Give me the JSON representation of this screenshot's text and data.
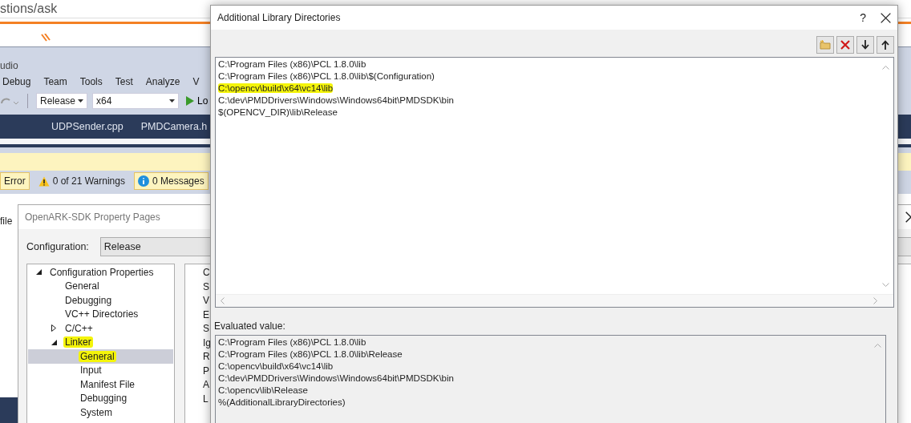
{
  "browser": {
    "address_fragment": "stions/ask"
  },
  "ide": {
    "title_fragment": "udio",
    "menu": [
      "Debug",
      "Team",
      "Tools",
      "Test",
      "Analyze",
      "V"
    ],
    "configuration": "Release",
    "platform": "x64",
    "run_label": "Lo",
    "tabs": [
      {
        "label": "UDPSender.cpp",
        "selected": false
      },
      {
        "label": "PMDCamera.h",
        "selected": false
      }
    ],
    "error_filters": [
      {
        "kind": "error",
        "label": "Error",
        "selected": true
      },
      {
        "kind": "warning",
        "label": "0 of 21 Warnings",
        "selected": false
      },
      {
        "kind": "info",
        "label": "0 Messages",
        "selected": true
      }
    ],
    "text_fragment": "file"
  },
  "property_pages": {
    "title": "OpenARK-SDK Property Pages",
    "configuration_label": "Configuration:",
    "configuration": "Release",
    "tree": [
      {
        "label": "Configuration Properties",
        "expanded": true,
        "selected": false,
        "highlighted": false,
        "children": [
          {
            "label": "General",
            "selected": false,
            "highlighted": false
          },
          {
            "label": "Debugging",
            "selected": false,
            "highlighted": false
          },
          {
            "label": "VC++ Directories",
            "selected": false,
            "highlighted": false
          },
          {
            "label": "C/C++",
            "expanded": false,
            "selected": false,
            "highlighted": false
          },
          {
            "label": "Linker",
            "expanded": true,
            "selected": false,
            "highlighted": true,
            "children": [
              {
                "label": "General",
                "selected": true,
                "highlighted": true
              },
              {
                "label": "Input",
                "selected": false,
                "highlighted": false
              },
              {
                "label": "Manifest File",
                "selected": false,
                "highlighted": false
              },
              {
                "label": "Debugging",
                "selected": false,
                "highlighted": false
              },
              {
                "label": "System",
                "selected": false,
                "highlighted": false
              }
            ]
          }
        ]
      }
    ],
    "property_fragments": [
      "C",
      "S",
      "V",
      "E",
      "S",
      "Ig",
      "R",
      "P",
      "A",
      "L"
    ]
  },
  "dialog": {
    "title": "Additional Library Directories",
    "help": "?",
    "toolbar": [
      {
        "kind": "new-folder"
      },
      {
        "kind": "delete"
      },
      {
        "kind": "move-down"
      },
      {
        "kind": "move-up"
      }
    ],
    "directories": [
      {
        "text": "C:\\Program Files (x86)\\PCL 1.8.0\\lib",
        "highlighted": false
      },
      {
        "text": "C:\\Program Files (x86)\\PCL 1.8.0\\lib\\$(Configuration)",
        "highlighted": false
      },
      {
        "text": "C:\\opencv\\build\\x64\\vc14\\lib",
        "highlighted": true
      },
      {
        "text": "C:\\dev\\PMDDrivers\\Windows\\Windows64bit\\PMDSDK\\bin",
        "highlighted": false
      },
      {
        "text": "$(OPENCV_DIR)\\lib\\Release",
        "highlighted": false
      }
    ],
    "evaluated_label": "Evaluated value:",
    "evaluated": [
      "C:\\Program Files (x86)\\PCL 1.8.0\\lib",
      "C:\\Program Files (x86)\\PCL 1.8.0\\lib\\Release",
      "C:\\opencv\\build\\x64\\vc14\\lib",
      "C:\\dev\\PMDDrivers\\Windows\\Windows64bit\\PMDSDK\\bin",
      "C:\\opencv\\lib\\Release",
      "%(AdditionalLibraryDirectories)"
    ]
  }
}
